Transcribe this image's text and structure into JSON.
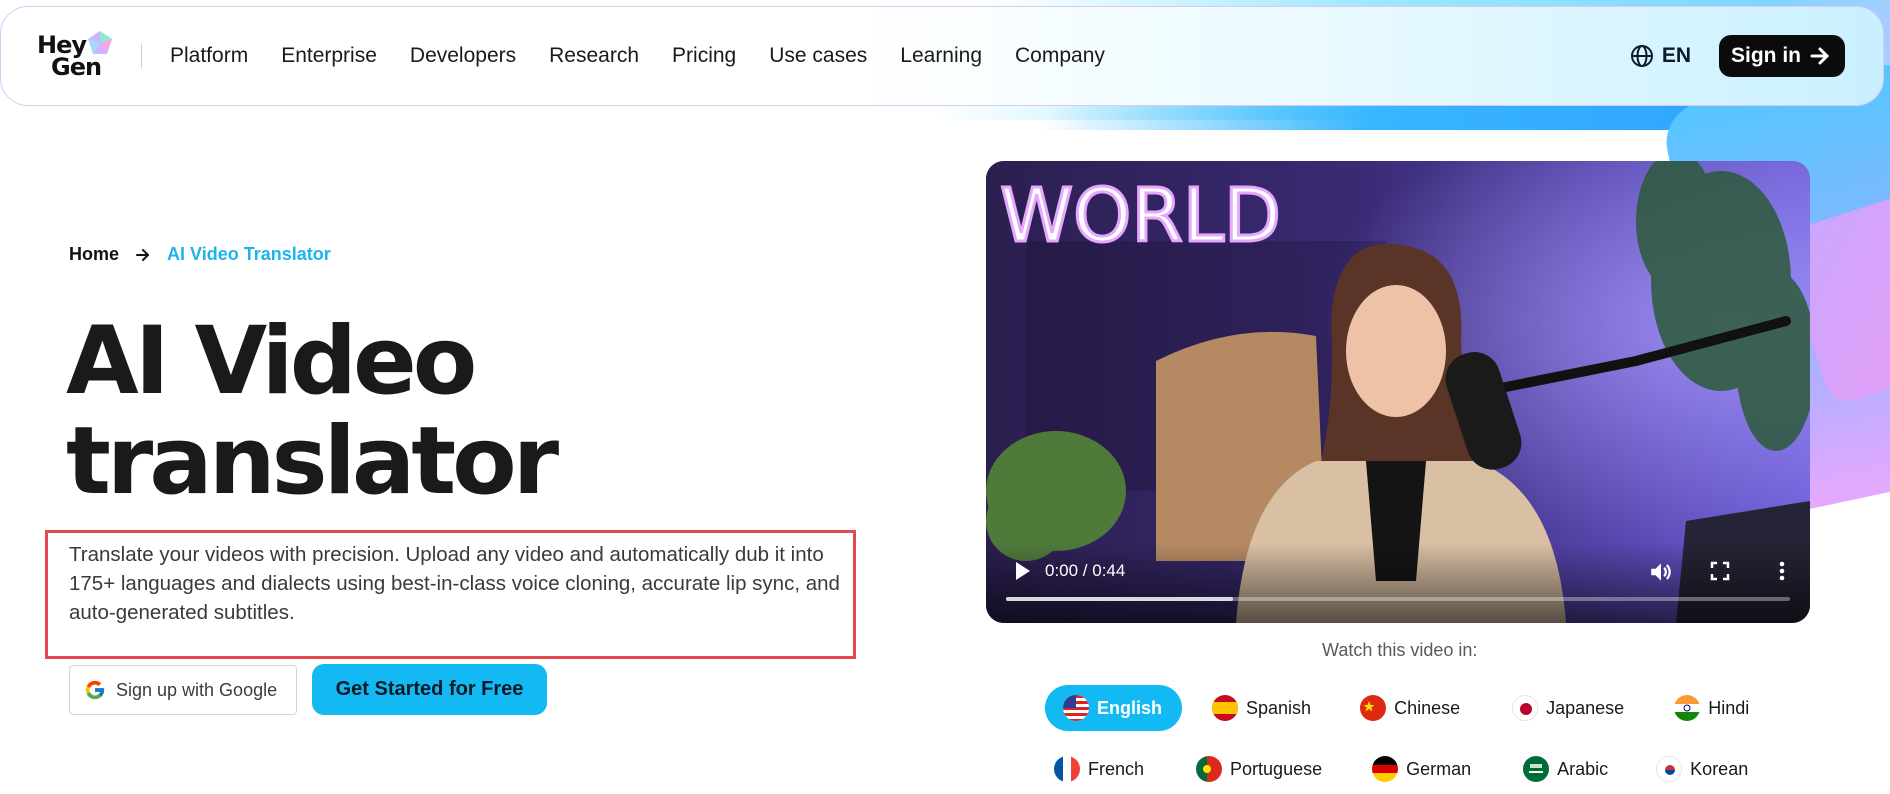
{
  "nav": {
    "logo_line1": "Hey",
    "logo_line2": "Gen",
    "links": [
      "Platform",
      "Enterprise",
      "Developers",
      "Research",
      "Pricing",
      "Use cases",
      "Learning",
      "Company"
    ],
    "language": "EN",
    "signin_label": "Sign in"
  },
  "breadcrumb": {
    "home": "Home",
    "current": "AI Video Translator"
  },
  "hero": {
    "title_line1": "AI Video",
    "title_line2": "translator",
    "description": "Translate your videos with precision. Upload any video and automatically dub it into 175+ languages and dialects using best-in-class voice cloning, accurate lip sync, and auto-generated subtitles."
  },
  "buttons": {
    "google_signup": "Sign up with Google",
    "get_started": "Get Started for Free"
  },
  "video": {
    "neon_text": "WORLD",
    "time": "0:00 / 0:44",
    "buffered_fraction": 0.29
  },
  "watch": {
    "label": "Watch this video in:",
    "languages_row1": [
      "English",
      "Spanish",
      "Chinese",
      "Japanese",
      "Hindi"
    ],
    "languages_row2": [
      "French",
      "Portuguese",
      "German",
      "Arabic",
      "Korean"
    ],
    "active": "English"
  },
  "colors": {
    "accent": "#13b9f3",
    "breadcrumb_active": "#1cb4ee",
    "highlight_box": "#e5484d"
  }
}
